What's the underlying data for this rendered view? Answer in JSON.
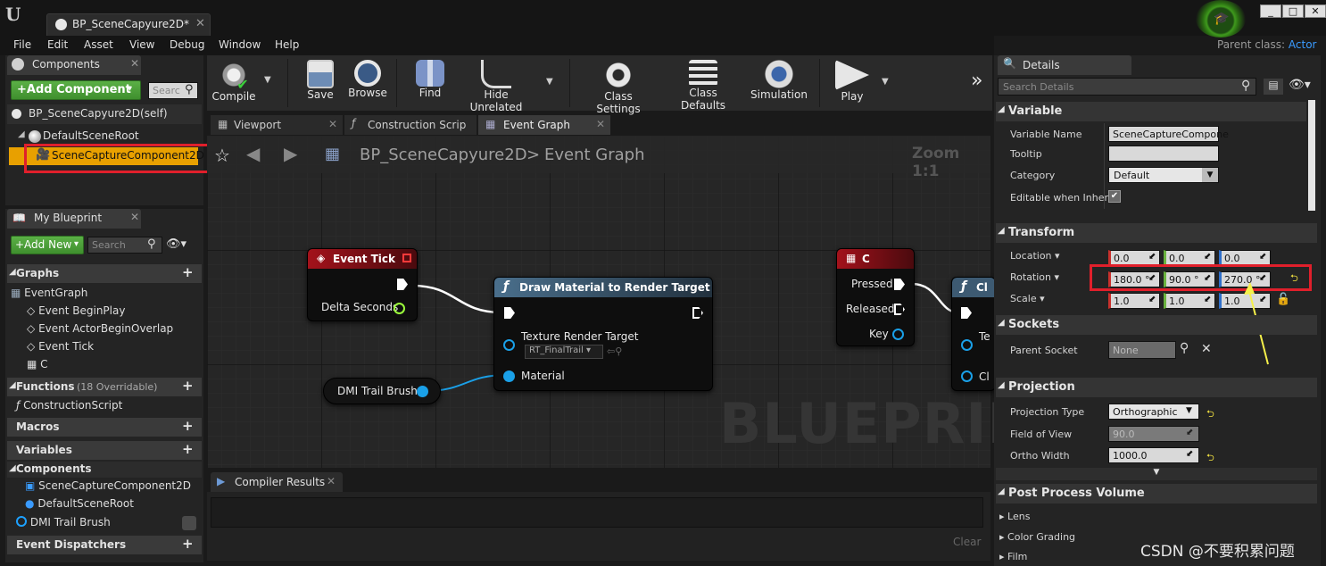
{
  "window": {
    "tab_title": "BP_SceneCapyure2D*",
    "parent_class_label": "Parent class:",
    "parent_class_value": "Actor",
    "minimize": "_",
    "maximize": "□",
    "close": "✕"
  },
  "menu": [
    "File",
    "Edit",
    "Asset",
    "View",
    "Debug",
    "Window",
    "Help"
  ],
  "components_panel": {
    "title": "Components",
    "add_button": "+Add Component",
    "search_placeholder": "Searc",
    "self_item": "BP_SceneCapyure2D(self)",
    "tree": [
      {
        "label": "DefaultSceneRoot",
        "icon": "scene-root-icon"
      },
      {
        "label": "SceneCaptureComponent2D",
        "icon": "scene-capture-icon",
        "selected": true
      }
    ]
  },
  "my_blueprint": {
    "title": "My Blueprint",
    "add_new": "+Add New",
    "search_placeholder": "Search",
    "graphs_label": "Graphs",
    "event_graph": "EventGraph",
    "events": [
      "Event BeginPlay",
      "Event ActorBeginOverlap",
      "Event Tick",
      "C"
    ],
    "functions_label": "Functions",
    "functions_note": "(18 Overridable)",
    "construction_script": "ConstructionScript",
    "macros_label": "Macros",
    "variables_label": "Variables",
    "components_label": "Components",
    "variable_components": [
      "SceneCaptureComponent2D",
      "DefaultSceneRoot"
    ],
    "dmi_variable": "DMI Trail Brush",
    "event_dispatchers_label": "Event Dispatchers"
  },
  "toolbar": {
    "buttons": [
      {
        "label": "Compile",
        "icon": "compile-gear-icon"
      },
      {
        "label": "Save",
        "icon": "save-disk-icon"
      },
      {
        "label": "Browse",
        "icon": "browse-magnifier-icon"
      },
      {
        "label": "Find",
        "icon": "find-binoculars-icon"
      },
      {
        "label": "Hide Unrelated",
        "icon": "hide-unrelated-icon"
      },
      {
        "label": "Class Settings",
        "icon": "class-settings-icon"
      },
      {
        "label": "Class Defaults",
        "icon": "class-defaults-icon"
      },
      {
        "label": "Simulation",
        "icon": "simulation-icon"
      },
      {
        "label": "Play",
        "icon": "play-icon"
      }
    ],
    "more": "»"
  },
  "graph_tabs": [
    {
      "label": "Viewport",
      "icon": "viewport-icon"
    },
    {
      "label": "Construction Scrip",
      "icon": "function-icon"
    },
    {
      "label": "Event Graph",
      "icon": "event-graph-icon",
      "active": true
    }
  ],
  "graph": {
    "breadcrumb_root": "BP_SceneCapyure2D",
    "breadcrumb_sep": ">",
    "breadcrumb_page": "Event Graph",
    "zoom": "Zoom 1:1",
    "watermark": "BLUEPRINT",
    "nodes": {
      "event_tick": {
        "title": "Event Tick",
        "pin_delta": "Delta Seconds"
      },
      "draw_material": {
        "title": "Draw Material to Render Target",
        "pin_texture": "Texture Render Target",
        "texture_value": "RT_FinalTrail",
        "pin_material": "Material"
      },
      "dmi_var": {
        "title": "DMI Trail Brush"
      },
      "key_c": {
        "title": "C",
        "pin_pressed": "Pressed",
        "pin_released": "Released",
        "pin_key": "Key"
      },
      "partial": {
        "title": "Cl",
        "pin_a": "Te",
        "pin_b": "Cl"
      }
    }
  },
  "compiler": {
    "title": "Compiler Results",
    "clear": "Clear"
  },
  "details": {
    "title": "Details",
    "search_placeholder": "Search Details",
    "variable_section": "Variable",
    "variable_name_label": "Variable Name",
    "variable_name_value": "SceneCaptureCompone",
    "tooltip_label": "Tooltip",
    "tooltip_value": "",
    "category_label": "Category",
    "category_value": "Default",
    "editable_label": "Editable when Inherit",
    "transform_section": "Transform",
    "location_label": "Location",
    "location": [
      "0.0",
      "0.0",
      "0.0"
    ],
    "rotation_label": "Rotation",
    "rotation": [
      "180.0 °",
      "90.0 °",
      "270.0 °"
    ],
    "scale_label": "Scale",
    "scale": [
      "1.0",
      "1.0",
      "1.0"
    ],
    "sockets_section": "Sockets",
    "parent_socket_label": "Parent Socket",
    "parent_socket_value": "None",
    "projection_section": "Projection",
    "projection_type_label": "Projection Type",
    "projection_type_value": "Orthographic",
    "fov_label": "Field of View",
    "fov_value": "90.0",
    "ortho_label": "Ortho Width",
    "ortho_value": "1000.0",
    "post_process_section": "Post Process Volume",
    "pp_items": [
      "Lens",
      "Color Grading",
      "Film"
    ]
  },
  "watermark_csdn": "CSDN @不要积累问题",
  "colors": {
    "highlight_red": "#e01f2b",
    "selection_orange": "#e8a000",
    "add_green": "#4fa33a",
    "arrow_yellow": "#f5f04a",
    "pin_blue": "#00a8ff",
    "exec_white": "#ffffff"
  }
}
